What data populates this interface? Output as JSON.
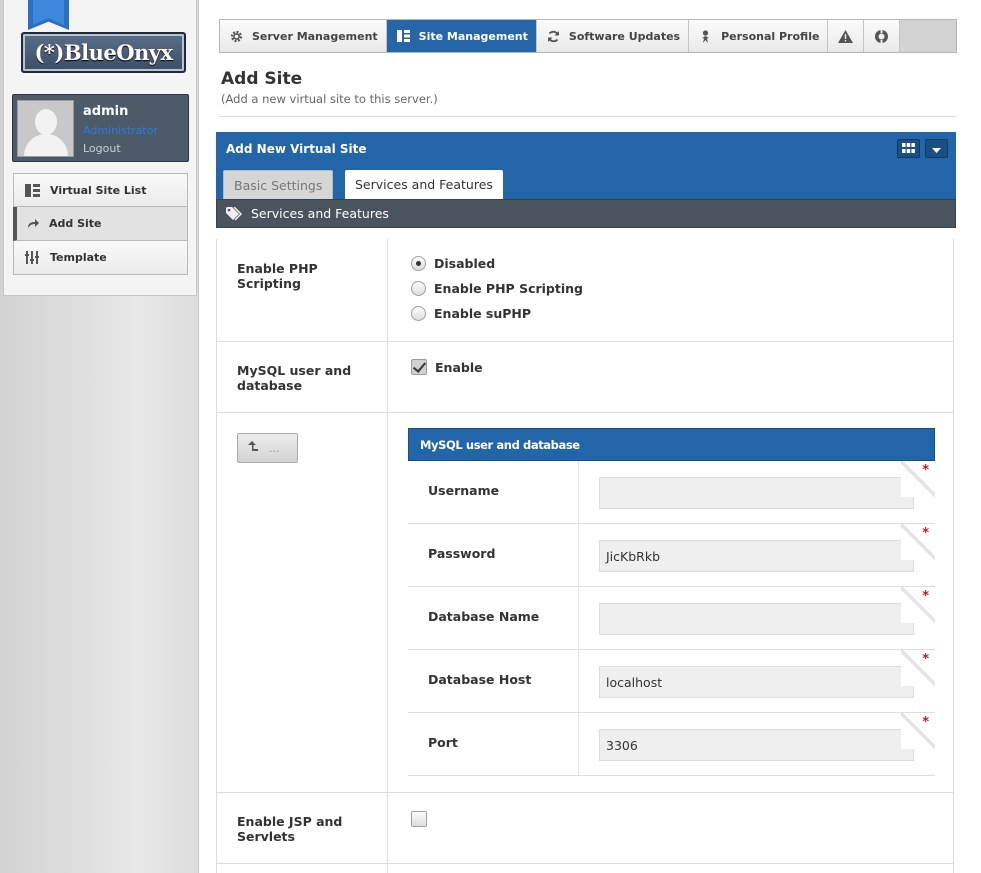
{
  "app": {
    "logo_text": "(*)BlueOnyx"
  },
  "user": {
    "name": "admin",
    "role": "Administrator",
    "logout": "Logout"
  },
  "sidebar": {
    "items": [
      {
        "label": "Virtual Site List",
        "icon": "grid-list-icon"
      },
      {
        "label": "Add Site",
        "icon": "share-arrow-icon"
      },
      {
        "label": "Template",
        "icon": "sliders-icon"
      }
    ]
  },
  "topnav": {
    "server": "Server Management",
    "site": "Site Management",
    "updates": "Software Updates",
    "profile": "Personal Profile"
  },
  "page": {
    "title": "Add Site",
    "subtitle": "(Add a new virtual site to this server.)"
  },
  "box": {
    "title": "Add New Virtual Site",
    "tabs": [
      "Basic Settings",
      "Services and Features"
    ],
    "section_title": "Services and Features"
  },
  "php": {
    "label": "Enable PHP Scripting",
    "options": [
      "Disabled",
      "Enable PHP Scripting",
      "Enable suPHP"
    ],
    "selected": "Disabled"
  },
  "mysql": {
    "label": "MySQL user and database",
    "enable_label": "Enable",
    "enabled": true,
    "back_button_label": "...",
    "subbox_title": "MySQL user and database",
    "fields": [
      {
        "label": "Username",
        "value": ""
      },
      {
        "label": "Password",
        "value": "JicKbRkb"
      },
      {
        "label": "Database Name",
        "value": ""
      },
      {
        "label": "Database Host",
        "value": "localhost"
      },
      {
        "label": "Port",
        "value": "3306"
      }
    ],
    "required_mark": "*"
  },
  "jsp": {
    "label": "Enable JSP and Servlets",
    "enabled": false
  },
  "colors": {
    "accent": "#2265a8",
    "section_bar": "#4a545e",
    "required": "#c0162c"
  }
}
